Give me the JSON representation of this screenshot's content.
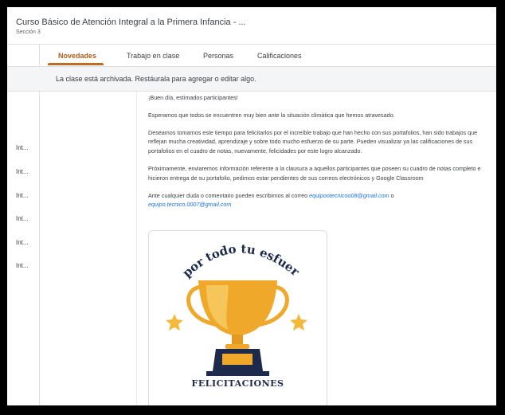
{
  "header": {
    "course_title": "Curso Básico de Atención Integral a la Primera Infancia - ...",
    "section": "Sección 3"
  },
  "tabs": [
    {
      "label": "Novedades",
      "active": true
    },
    {
      "label": "Trabajo en clase",
      "active": false
    },
    {
      "label": "Personas",
      "active": false
    },
    {
      "label": "Calificaciones",
      "active": false
    }
  ],
  "notice": "La clase está archivada. Restáurala para agregar o editar algo.",
  "sidebar": {
    "items": [
      "Int...",
      "Int...",
      "Int...",
      "Int...",
      "Int...",
      "Int..."
    ]
  },
  "post": {
    "greeting": "¡Buen día, estimados participantes!",
    "p1": "Esperamos que todos se encuentren muy bien ante la situación climática que hemos atravesado.",
    "p2": "Deseamos tomarnos este tiempo para felicitarlos por el increíble trabajo que han hecho con sus portafolios, han sido trabajos que reflejan mucha creatividad, aprendizaje y sobre todo mucho esfuerzo de su parte. Pueden visualizar ya las calificaciones de sus portafolios en el cuadro de notas, nuevamente, felicidades por este logro alcanzado.",
    "p3": "Próximamente, enviaremos información referente a la clausura a aquellos participantes que poseen su cuadro de notas completo e hicieron entrega de su portafolio, pedimos estar pendientes de sus correos electrónicos y Google Classroom",
    "p4_pre": "Ante cualquier duda o comentario pueden escribirnos al correo ",
    "email1": "equipootecnicoo08@gmail.com",
    "p4_mid": " o",
    "email2": "equipo.tecnico.0007@gmail.com"
  },
  "image_card": {
    "banner_text": "por todo tu esfuerzo",
    "caption": "FELICITACIONES",
    "colors": {
      "gold": "#f0a82a",
      "navy": "#1d2a4b",
      "star": "#f4b93a"
    }
  }
}
